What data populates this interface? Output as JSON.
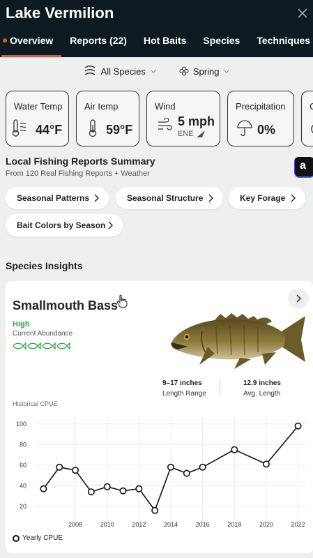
{
  "header": {
    "title": "Lake Vermilion",
    "tabs": [
      {
        "label": "Overview",
        "active": true
      },
      {
        "label": "Reports (22)"
      },
      {
        "label": "Hot Baits"
      },
      {
        "label": "Species"
      },
      {
        "label": "Techniques"
      }
    ]
  },
  "filters": {
    "species": "All Species",
    "season": "Spring"
  },
  "weather": [
    {
      "label": "Water Temp",
      "value": "44°F",
      "icon": "water-thermometer-icon"
    },
    {
      "label": "Air temp",
      "value": "59°F",
      "icon": "thermometer-icon"
    },
    {
      "label": "Wind",
      "value": "5 mph",
      "sub": "ENE",
      "icon": "wind-icon"
    },
    {
      "label": "Precipitation",
      "value": "0%",
      "icon": "umbrella-icon"
    },
    {
      "label": "C",
      "icon": "cloud-icon"
    }
  ],
  "summary": {
    "title": "Local Fishing Reports Summary",
    "subtitle": "From 120 Real Fishing Reports + Weather",
    "pills": [
      "Seasonal Patterns",
      "Seasonal Structure",
      "Key Forage",
      "Bait Colors by Season"
    ]
  },
  "species_insights": {
    "title": "Species Insights",
    "species": "Smallmouth Bass",
    "abundance": "High",
    "abundance_label": "Current Abundance",
    "abundance_level": 4,
    "length_range": "9–17 inches",
    "length_range_label": "Length Range",
    "avg_length": "12.9 inches",
    "avg_length_label": "Avg. Length",
    "chart_title": "Historical CPUE",
    "legend": "Yearly CPUE"
  },
  "colors": {
    "header_bg": "#0d1a22",
    "accent": "#e8542b",
    "abundance_green": "#2fa84a"
  },
  "chart_data": {
    "type": "line",
    "title": "Historical CPUE",
    "series": [
      {
        "name": "Yearly CPUE",
        "x": [
          2006,
          2007,
          2008,
          2009,
          2010,
          2011,
          2012,
          2013,
          2014,
          2015,
          2016,
          2018,
          2020,
          2022
        ],
        "values": [
          37,
          58,
          55,
          34,
          39,
          35,
          37,
          16,
          58,
          52,
          58,
          75,
          61,
          98
        ]
      }
    ],
    "xticks": [
      2008,
      2010,
      2012,
      2014,
      2016,
      2018,
      2020,
      2022
    ],
    "yticks": [
      20,
      40,
      60,
      80,
      100
    ],
    "xlim": [
      2005.5,
      2022.5
    ],
    "ylim": [
      5,
      108
    ],
    "grid": true,
    "legend": "bottom-left"
  }
}
